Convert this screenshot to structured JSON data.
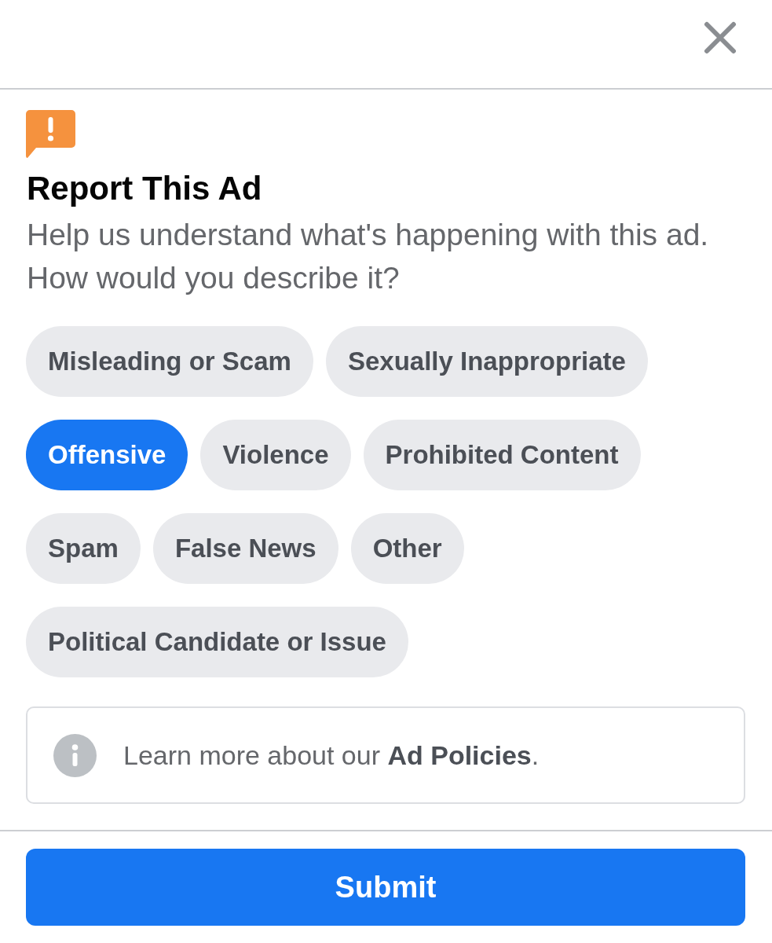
{
  "report": {
    "title": "Report This Ad",
    "description": "Help us understand what's happening with this ad. How would you describe it?"
  },
  "options": [
    {
      "label": "Misleading or Scam",
      "selected": false
    },
    {
      "label": "Sexually Inappropriate",
      "selected": false
    },
    {
      "label": "Offensive",
      "selected": true
    },
    {
      "label": "Violence",
      "selected": false
    },
    {
      "label": "Prohibited Content",
      "selected": false
    },
    {
      "label": "Spam",
      "selected": false
    },
    {
      "label": "False News",
      "selected": false
    },
    {
      "label": "Other",
      "selected": false
    },
    {
      "label": "Political Candidate or Issue",
      "selected": false
    }
  ],
  "info": {
    "text": "Learn more about our **Ad Policies**."
  },
  "submit_button": {
    "label": "Submit"
  }
}
